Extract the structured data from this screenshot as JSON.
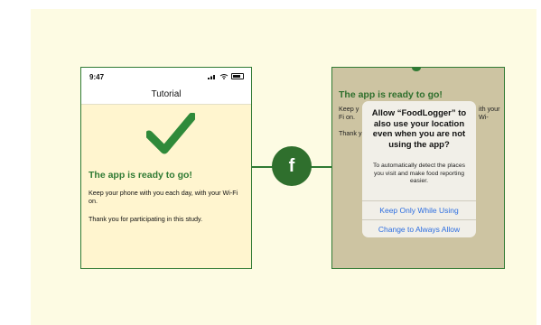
{
  "left_phone": {
    "status_time": "9:47",
    "nav_title": "Tutorial",
    "heading": "The app is ready to go!",
    "line1": "Keep your phone with you each day, with your Wi-Fi on.",
    "line2": "Thank you for participating in this study."
  },
  "badge": {
    "label": "f"
  },
  "right_phone": {
    "heading": "The app is ready to go!",
    "bg_line_keep": "Keep y",
    "bg_line_keep_end": "ith your Wi-",
    "bg_line_fion": "Fi on.",
    "bg_line_thank": "Thank y",
    "dialog": {
      "title": "Allow “FoodLogger” to also use your location even when you are not using the app?",
      "message": "To automatically detect the places you visit and make food reporting easier.",
      "button_keep": "Keep Only While Using",
      "button_always": "Change to Always Allow"
    }
  },
  "colors": {
    "green": "#2f7a33",
    "cream": "#fff5cf",
    "ios_blue": "#2d6ee0"
  }
}
